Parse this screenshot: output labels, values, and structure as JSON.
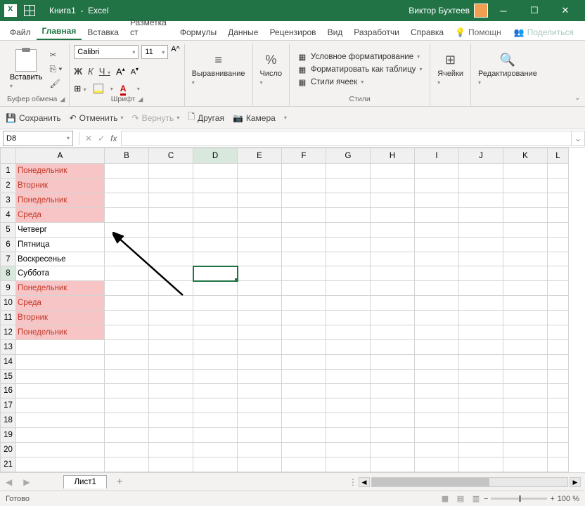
{
  "titlebar": {
    "doc": "Книга1",
    "app": "Excel",
    "user": "Виктор Бухтеев"
  },
  "tabs": {
    "file": "Файл",
    "home": "Главная",
    "insert": "Вставка",
    "layout": "Разметка ст",
    "formulas": "Формулы",
    "data": "Данные",
    "review": "Рецензиров",
    "view": "Вид",
    "dev": "Разработчи",
    "ref": "Справка"
  },
  "help": "Помощн",
  "share": "Поделиться",
  "ribbon": {
    "clipboard": {
      "paste": "Вставить",
      "label": "Буфер обмена"
    },
    "font": {
      "name": "Calibri",
      "size": "11",
      "label": "Шрифт"
    },
    "align": {
      "label": "Выравнивание"
    },
    "number": {
      "label": "Число"
    },
    "styles": {
      "cond": "Условное форматирование",
      "table": "Форматировать как таблицу",
      "cell": "Стили ячеек",
      "label": "Стили"
    },
    "cells": {
      "label": "Ячейки"
    },
    "edit": {
      "label": "Редактирование"
    }
  },
  "qat": {
    "save": "Сохранить",
    "undo": "Отменить",
    "redo": "Вернуть",
    "other": "Другая",
    "camera": "Камера"
  },
  "namebox": "D8",
  "cols": [
    "A",
    "B",
    "C",
    "D",
    "E",
    "F",
    "G",
    "H",
    "I",
    "J",
    "K",
    "L"
  ],
  "rows": [
    "1",
    "2",
    "3",
    "4",
    "5",
    "6",
    "7",
    "8",
    "9",
    "10",
    "11",
    "12",
    "13",
    "14",
    "15",
    "16",
    "17",
    "18",
    "19",
    "20",
    "21"
  ],
  "cells": {
    "A1": "Понедельник",
    "A2": "Вторник",
    "A3": "Понедельник",
    "A4": "Среда",
    "A5": "Четверг",
    "A6": "Пятница",
    "A7": "Воскресенье",
    "A8": "Суббота",
    "A9": "Понедельник",
    "A10": "Среда",
    "A11": "Вторник",
    "A12": "Понедельник"
  },
  "highlighted": [
    "A1",
    "A2",
    "A3",
    "A4",
    "A9",
    "A10",
    "A11",
    "A12"
  ],
  "selected": "D8",
  "sheet": "Лист1",
  "status": "Готово",
  "zoom": "100 %"
}
